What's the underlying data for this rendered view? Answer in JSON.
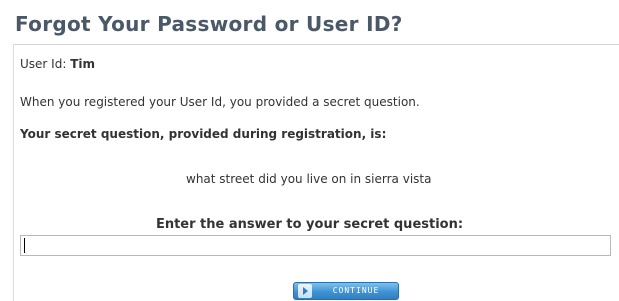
{
  "page": {
    "title": "Forgot Your Password or User ID?"
  },
  "user": {
    "label": "User Id:",
    "value": "Tim"
  },
  "info_text": "When you registered your User Id, you provided a secret question.",
  "secret_question": {
    "label": "Your secret question, provided during registration, is:",
    "question": "what street did you live on in sierra vista"
  },
  "answer": {
    "label": "Enter the answer to your secret question:",
    "value": ""
  },
  "actions": {
    "continue_label": "CONTINUE"
  },
  "colors": {
    "title": "#4a5868",
    "button_blue": "#3f93d3"
  },
  "icons": {
    "continue_arrow": "arrow-right-icon"
  }
}
